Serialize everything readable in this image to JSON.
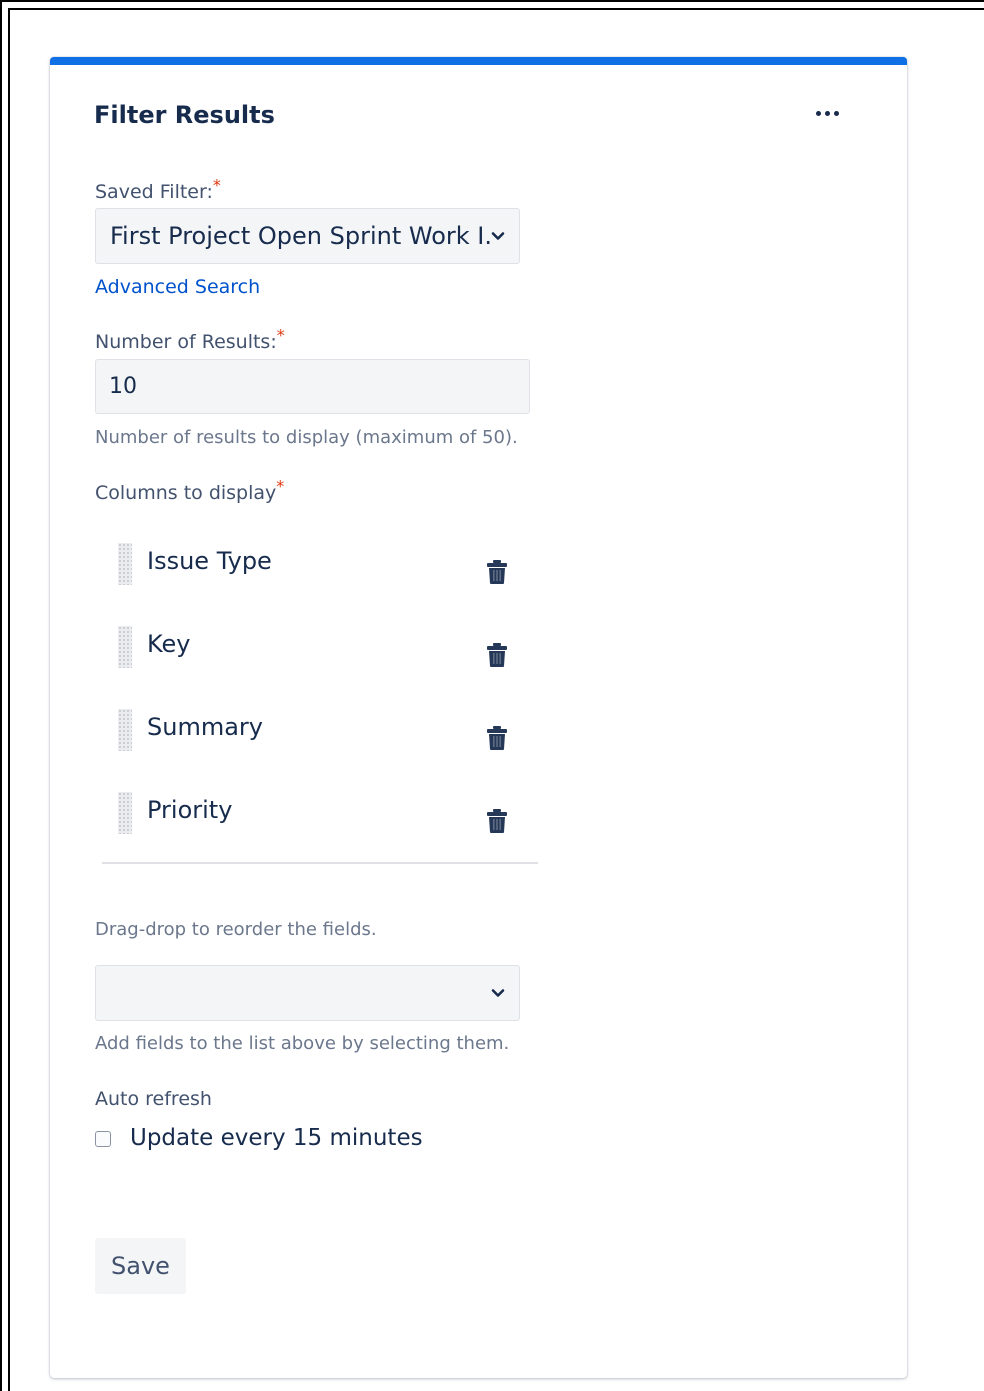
{
  "gadget": {
    "title": "Filter Results",
    "accent_color": "#0f6fe5"
  },
  "saved_filter": {
    "label": "Saved Filter:",
    "required_mark": "*",
    "value": "First Project Open Sprint Work I..."
  },
  "advanced_search": {
    "label": "Advanced Search"
  },
  "number_of_results": {
    "label": "Number of Results:",
    "required_mark": "*",
    "value": "10",
    "help": "Number of results to display (maximum of 50)."
  },
  "columns": {
    "label": "Columns to display",
    "required_mark": "*",
    "items": [
      {
        "label": "Issue Type"
      },
      {
        "label": "Key"
      },
      {
        "label": "Summary"
      },
      {
        "label": "Priority"
      }
    ],
    "drag_help": "Drag-drop to reorder the fields.",
    "add_select_value": "",
    "add_help": "Add fields to the list above by selecting them."
  },
  "auto_refresh": {
    "label": "Auto refresh",
    "checkbox_label": "Update every 15 minutes",
    "checked": false
  },
  "save": {
    "label": "Save"
  }
}
